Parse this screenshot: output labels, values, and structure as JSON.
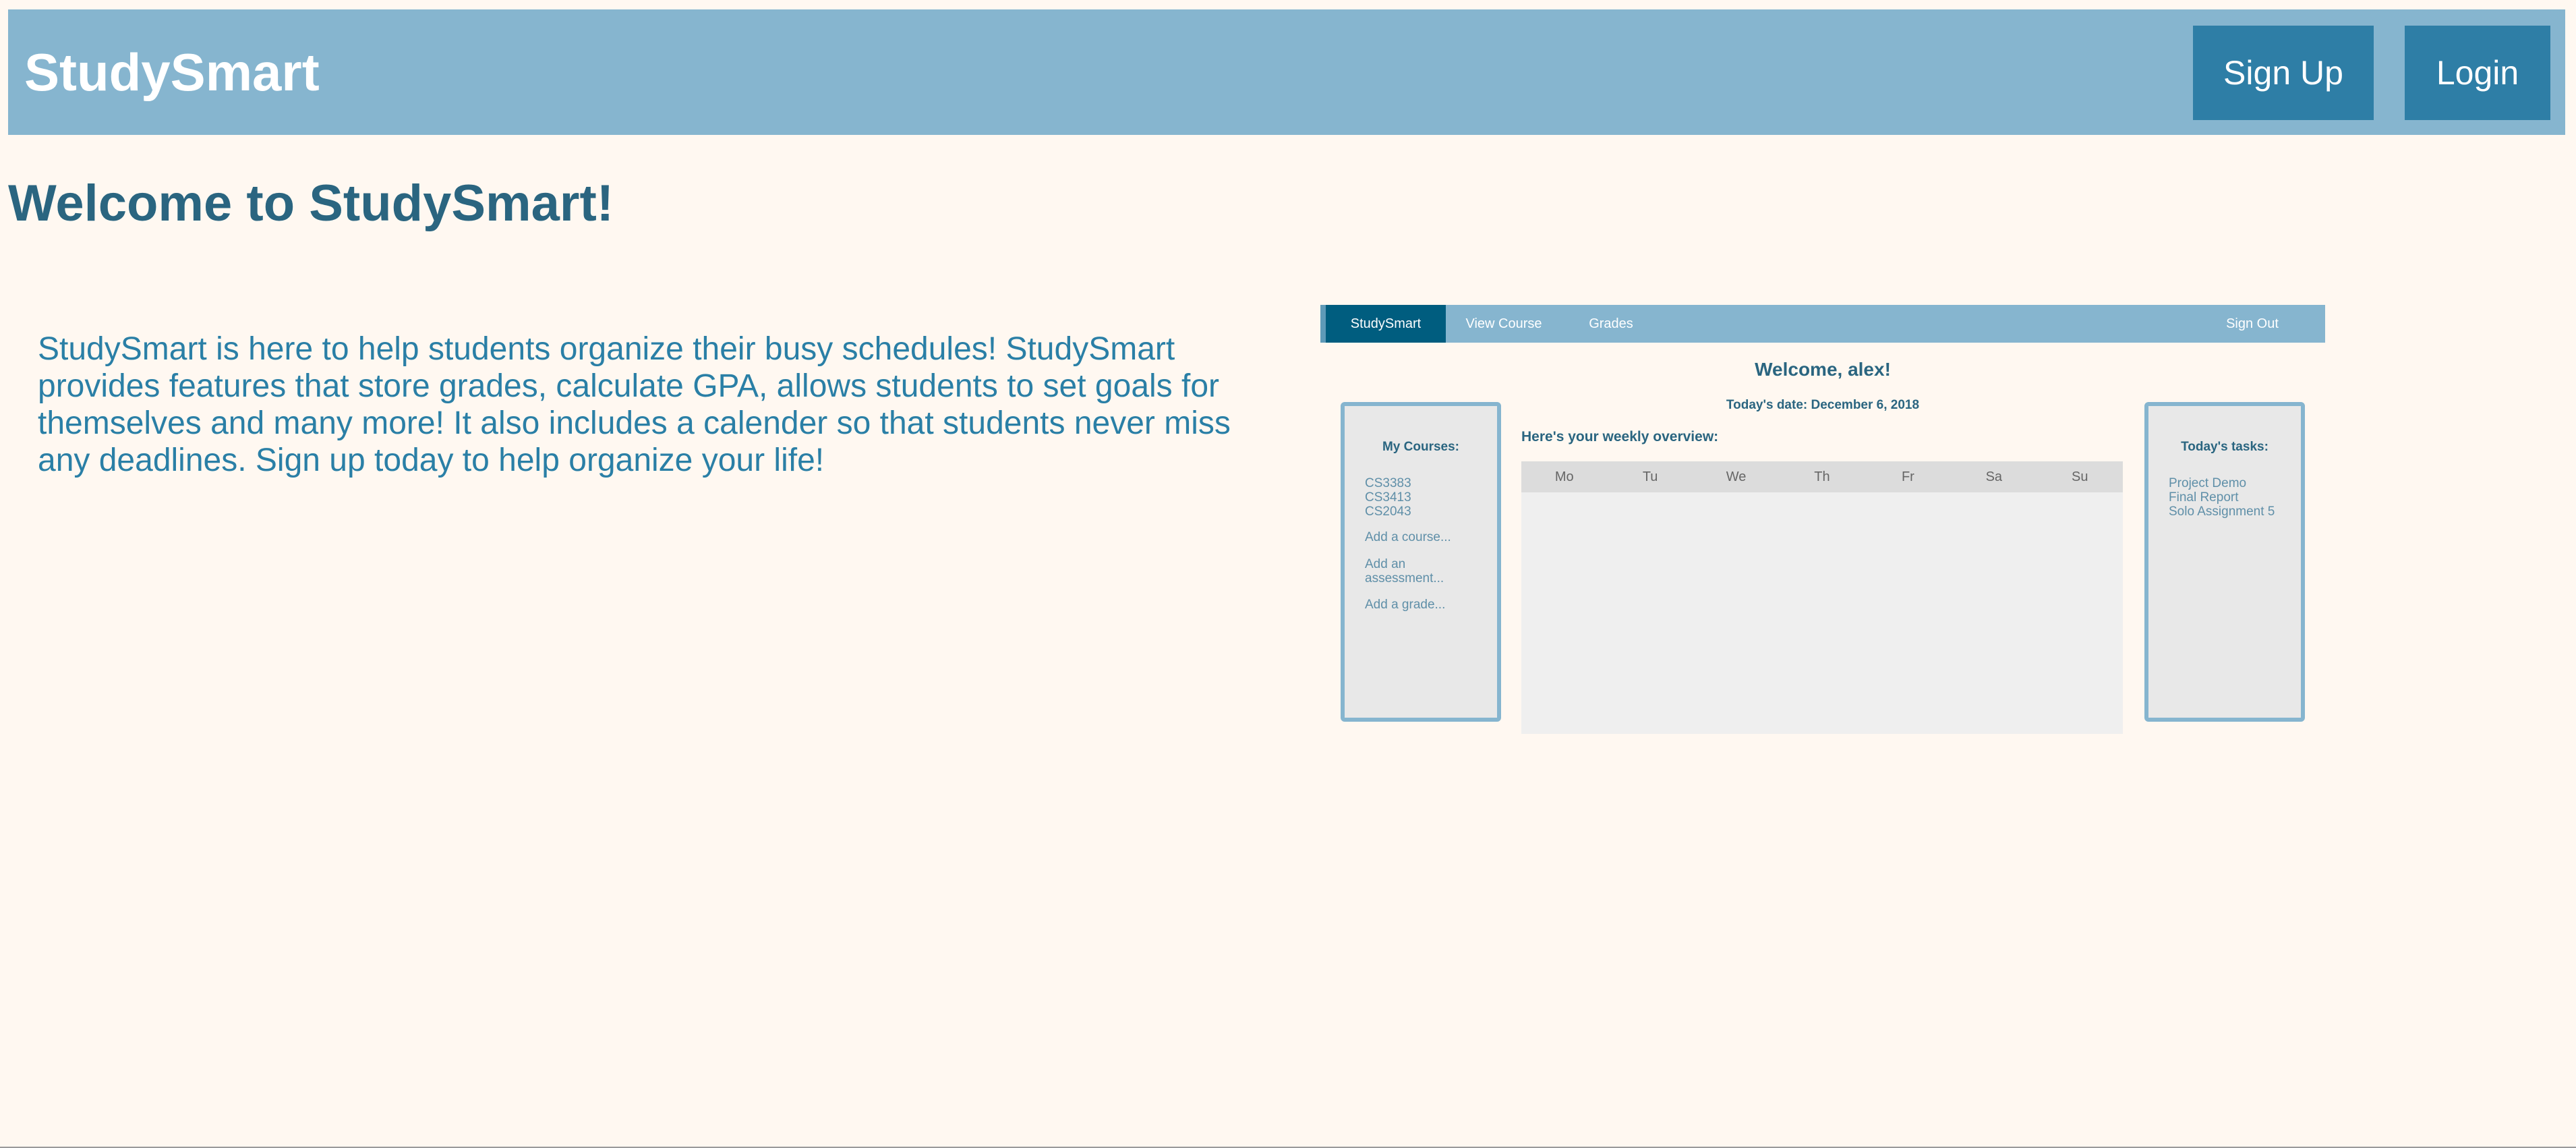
{
  "header": {
    "brand": "StudySmart",
    "signup_label": "Sign Up",
    "login_label": "Login"
  },
  "main": {
    "title": "Welcome to StudySmart!",
    "intro": "StudySmart is here to help students organize their busy schedules! StudySmart provides features that store grades, calculate GPA, allows students to set goals for themselves and many more! It also includes a calender so that students never miss any deadlines. Sign up today to help organize your life!"
  },
  "preview": {
    "nav": {
      "brand": "StudySmart",
      "view_course": "View Course",
      "grades": "Grades",
      "sign_out": "Sign Out"
    },
    "welcome": "Welcome, alex!",
    "date": "Today's date: December 6, 2018",
    "courses_panel": {
      "title": "My Courses:",
      "courses": [
        "CS3383",
        "CS3413",
        "CS2043"
      ],
      "add_course": "Add a course...",
      "add_assessment": "Add an assessment...",
      "add_grade": "Add a grade..."
    },
    "overview_title": "Here's your weekly overview:",
    "days": [
      "Mo",
      "Tu",
      "We",
      "Th",
      "Fr",
      "Sa",
      "Su"
    ],
    "tasks_panel": {
      "title": "Today's tasks:",
      "tasks": [
        "Project Demo",
        "Final Report",
        "Solo Assignment 5"
      ]
    }
  },
  "colors": {
    "header_bg": "#86b5cf",
    "button_bg": "#2e7ea6",
    "page_bg": "#fff8f1",
    "title": "#2a6580",
    "intro_text": "#2a7fa6",
    "nav_active": "#005d7f"
  }
}
